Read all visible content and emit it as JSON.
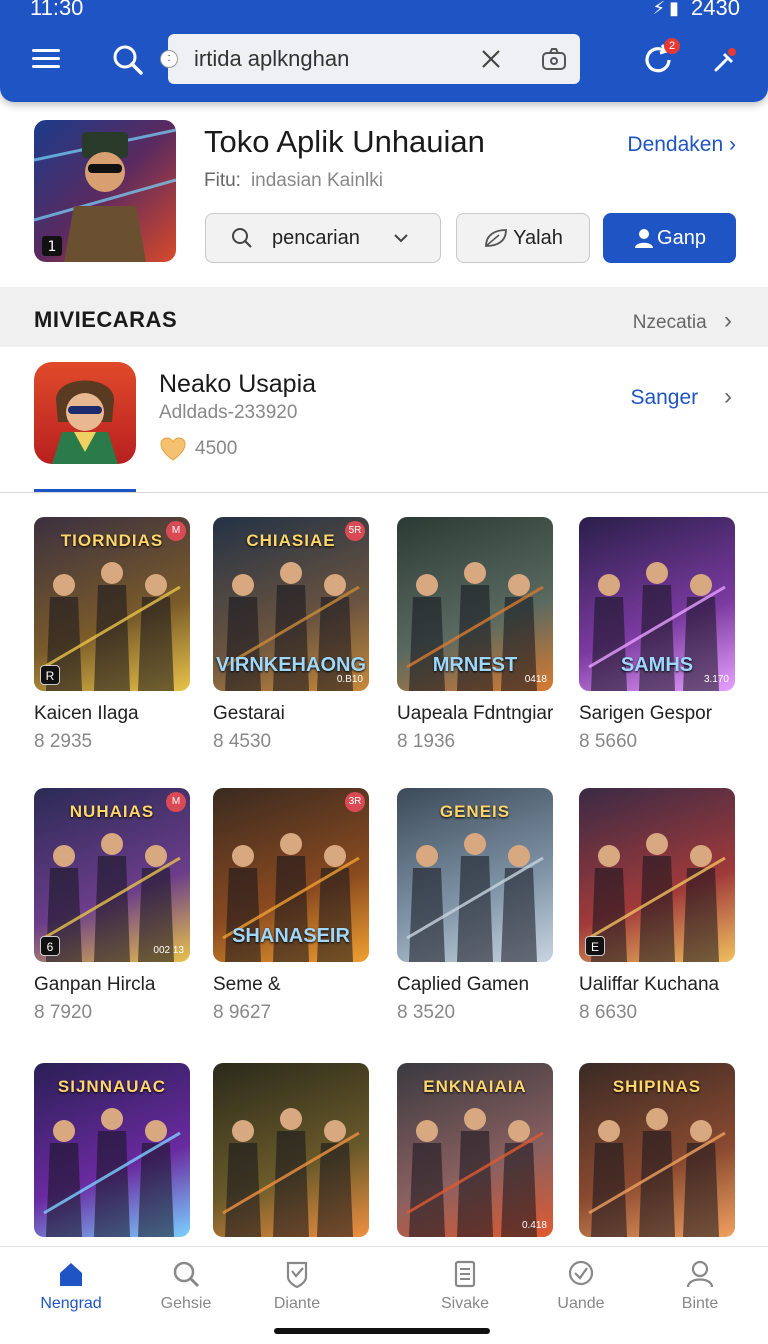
{
  "status": {
    "time": "11:30",
    "right": "2430"
  },
  "search": {
    "value": "irtida aplknghan"
  },
  "app": {
    "title": "Toko Aplik Unhauian",
    "sub_label": "Fitu:",
    "sub_value": "indasian Kainlki",
    "open_link": "Dendaken",
    "search_pill": "pencarian",
    "yalah_button": "Yalah",
    "ganp_button": "Ganp"
  },
  "section": {
    "title": "MIVIECARAS",
    "more": "Nzecatia"
  },
  "featured": {
    "title": "Neako Usapia",
    "sub": "Adldads-233920",
    "likes": "4500",
    "link": "Sanger"
  },
  "games": [
    {
      "name": "Kaicen Ilaga",
      "count": "8 2935",
      "banner": "TIORNDIAS",
      "banner2": "",
      "tag": "R",
      "corner": "M",
      "code": "",
      "colors": [
        "#3b3040",
        "#7a5b2a",
        "#e8c34a"
      ]
    },
    {
      "name": "Gestarai",
      "count": "8 4530",
      "banner": "CHIASIAE",
      "banner2": "VIRNKEHAONG",
      "tag": "",
      "corner": "5R",
      "code": "0.B10",
      "colors": [
        "#233245",
        "#6a5440",
        "#c88a3a"
      ]
    },
    {
      "name": "Uapeala Fdntngiar",
      "count": "8 1936",
      "banner": "",
      "banner2": "MRNEST",
      "tag": "",
      "corner": "",
      "code": "0418",
      "colors": [
        "#2c3a35",
        "#5a6a60",
        "#d97a30"
      ]
    },
    {
      "name": "Sarigen Gespor",
      "count": "8 5660",
      "banner": "",
      "banner2": "SAMHS",
      "tag": "",
      "corner": "",
      "code": "3.170",
      "colors": [
        "#2a1f4a",
        "#7b3aa0",
        "#e6a0ff"
      ]
    },
    {
      "name": "Ganpan Hircla",
      "count": "8 7920",
      "banner": "NUHAIAS",
      "banner2": "",
      "tag": "6",
      "corner": "M",
      "code": "002 13",
      "colors": [
        "#2b2a55",
        "#6b3d8a",
        "#e8c34a"
      ]
    },
    {
      "name": "Seme &",
      "count": "8 9627",
      "banner": "",
      "banner2": "SHANASEIR",
      "tag": "",
      "corner": "3R",
      "code": "",
      "colors": [
        "#3a2a20",
        "#8a4a20",
        "#f0a030"
      ]
    },
    {
      "name": "Caplied Gamen",
      "count": "8 3520",
      "banner": "GENEIS",
      "banner2": "",
      "tag": "",
      "corner": "",
      "code": "",
      "colors": [
        "#3c4a58",
        "#8095a8",
        "#c8d4e0"
      ]
    },
    {
      "name": "Ualiffar Kuchana",
      "count": "8 6630",
      "banner": "",
      "banner2": "",
      "tag": "E",
      "corner": "",
      "code": "",
      "colors": [
        "#3a2a45",
        "#a03a3a",
        "#f0c060"
      ]
    },
    {
      "name": "",
      "count": "",
      "banner": "SIJNNAUAC",
      "banner2": "",
      "tag": "",
      "corner": "",
      "code": "",
      "colors": [
        "#2a1f55",
        "#6a2aa0",
        "#7cd0ff"
      ]
    },
    {
      "name": "",
      "count": "",
      "banner": "",
      "banner2": "",
      "tag": "",
      "corner": "",
      "code": "",
      "colors": [
        "#2a2a1a",
        "#6a5a2a",
        "#f09040"
      ]
    },
    {
      "name": "",
      "count": "",
      "banner": "ENKNAIAIA",
      "banner2": "",
      "tag": "",
      "corner": "",
      "code": "0.418",
      "colors": [
        "#3a3a40",
        "#8a6060",
        "#e05a30"
      ]
    },
    {
      "name": "",
      "count": "",
      "banner": "SHIPINAS",
      "banner2": "",
      "tag": "",
      "corner": "",
      "code": "",
      "colors": [
        "#3a2a25",
        "#8a4a30",
        "#f0a060"
      ]
    }
  ],
  "nav": [
    {
      "label": "Nengrad",
      "icon": "home-icon",
      "active": true
    },
    {
      "label": "Gehsie",
      "icon": "search-icon",
      "active": false
    },
    {
      "label": "Diante",
      "icon": "shield-icon",
      "active": false
    },
    {
      "label": "Sivake",
      "icon": "document-icon",
      "active": false
    },
    {
      "label": "Uande",
      "icon": "badge-check-icon",
      "active": false
    },
    {
      "label": "Binte",
      "icon": "person-icon",
      "active": false
    }
  ],
  "colors": {
    "accent": "#1f54c4",
    "badge": "#e53935"
  }
}
